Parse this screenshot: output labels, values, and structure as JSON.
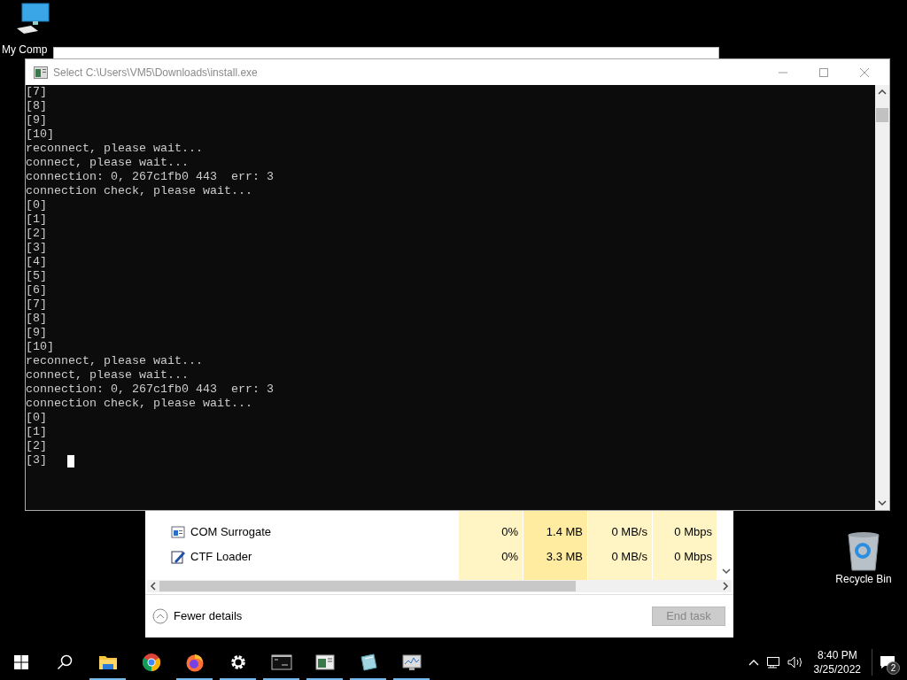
{
  "desktop_icons": [
    {
      "kind": "computer",
      "label": "My Comp"
    },
    {
      "kind": "recycle",
      "label": "Recycle Bin"
    }
  ],
  "console": {
    "title": "Select C:\\Users\\VM5\\Downloads\\install.exe",
    "cursor": true,
    "lines": [
      "[7]",
      "[8]",
      "[9]",
      "[10]",
      "reconnect, please wait...",
      "connect, please wait...",
      "connection: 0, 267c1fb0 443  err: 3",
      "connection check, please wait...",
      "[0]",
      "[1]",
      "[2]",
      "[3]",
      "[4]",
      "[5]",
      "[6]",
      "[7]",
      "[8]",
      "[9]",
      "[10]",
      "reconnect, please wait...",
      "connect, please wait...",
      "connection: 0, 267c1fb0 443  err: 3",
      "connection check, please wait...",
      "[0]",
      "[1]",
      "[2]",
      "[3]"
    ]
  },
  "task_manager": {
    "rows": [
      {
        "kind": "com",
        "name": "COM Surrogate",
        "cpu": "0%",
        "memory": "1.4 MB",
        "disk": "0 MB/s",
        "network": "0 Mbps"
      },
      {
        "kind": "ctf",
        "name": "CTF Loader",
        "cpu": "0%",
        "memory": "3.3 MB",
        "disk": "0 MB/s",
        "network": "0 Mbps"
      }
    ],
    "toggle": "Fewer details",
    "end_task": {
      "label": "End task",
      "disabled": true
    }
  },
  "taskbar": {
    "apps": [
      {
        "kind": "explorer",
        "running": true
      },
      {
        "kind": "chrome",
        "running": false
      },
      {
        "kind": "firefox",
        "running": true
      },
      {
        "kind": "settings",
        "running": true
      },
      {
        "kind": "cmd",
        "running": true
      },
      {
        "kind": "notepad",
        "running": true
      },
      {
        "kind": "pencil",
        "running": true
      },
      {
        "kind": "taskmgr",
        "running": true
      }
    ],
    "time": "8:40 PM",
    "date": "3/25/2022",
    "notifications": "2"
  }
}
